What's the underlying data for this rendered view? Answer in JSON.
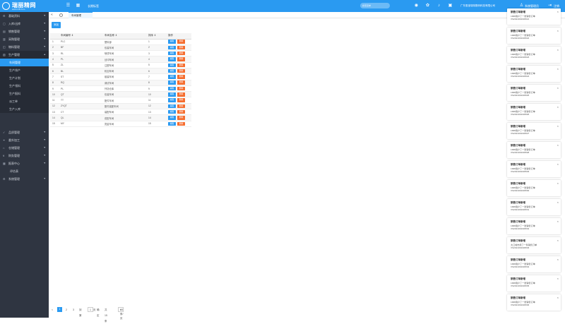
{
  "topbar": {
    "logo_text": "瑞丽精网",
    "logo_sub": "www.ruili.com",
    "menu_label": "长期标签",
    "search_placeholder": "搜索菜单",
    "company": "广东惠宝瑞帝数码科技有限公司",
    "user": "系统管理员",
    "logout": "注销",
    "colors": {
      "accent": "#2a9af1",
      "sidebar": "#2f3541",
      "danger": "#f56c2d"
    }
  },
  "sidebar": {
    "items": [
      {
        "label": "基础资料",
        "icon": "gear-icon"
      },
      {
        "label": "入库/出库",
        "icon": "box-icon"
      },
      {
        "label": "销售管理",
        "icon": "cart-icon"
      },
      {
        "label": "采购管理",
        "icon": "truck-icon"
      },
      {
        "label": "物料管理",
        "icon": "cube-icon"
      },
      {
        "label": "生产管理",
        "icon": "factory-icon"
      }
    ],
    "sub_items": [
      "车间管理",
      "生产排产",
      "生产计划",
      "生产领料",
      "生产报料",
      "派工单",
      "生产入库"
    ],
    "items2": [
      {
        "label": "品质管理",
        "icon": "check-icon"
      },
      {
        "label": "委外加工",
        "icon": "link-icon"
      },
      {
        "label": "仓储管理",
        "icon": "warehouse-icon"
      },
      {
        "label": "财务管理",
        "icon": "money-icon"
      },
      {
        "label": "报表中心",
        "icon": "chart-icon"
      },
      {
        "label": "评估表",
        "icon": ""
      },
      {
        "label": "系统管理",
        "icon": "settings-icon"
      }
    ]
  },
  "tabs": {
    "active": "车间管理"
  },
  "toolbar": {
    "add_label": "添加"
  },
  "table": {
    "headers": [
      "",
      "车间编号",
      "车间名称",
      "排序",
      "操作"
    ],
    "edit_label": "编辑",
    "delete_label": "删除",
    "rows": [
      [
        "1",
        "PLC",
        "塑料部",
        "1"
      ],
      [
        "2",
        "BF",
        "包装车间",
        "2"
      ],
      [
        "3",
        "RL",
        "喷漆车间",
        "3"
      ],
      [
        "4",
        "PL",
        "丝印车间",
        "4"
      ],
      [
        "5",
        "ZL",
        "注塑车间",
        "5"
      ],
      [
        "6",
        "BL",
        "机加车间",
        "6"
      ],
      [
        "7",
        "ST",
        "组装车间",
        "7"
      ],
      [
        "8",
        "RQ",
        "调试车间",
        "8"
      ],
      [
        "9",
        "PL",
        "外协仓库",
        "9"
      ],
      [
        "10",
        "QT",
        "包装车间",
        "10"
      ],
      [
        "11",
        "TT",
        "配件车间",
        "11"
      ],
      [
        "12",
        "ZYQT",
        "配件装配车间",
        "12"
      ],
      [
        "13",
        "CT",
        "装配车间",
        "13"
      ],
      [
        "14",
        "QL",
        "成型车间",
        "14"
      ],
      [
        "15",
        "MY",
        "烫金车间",
        "15"
      ]
    ]
  },
  "pager": {
    "prev": "<",
    "current": "1",
    "next_pages": [
      "2",
      "3"
    ],
    "goto": "到第",
    "page": "1",
    "page_unit": "页",
    "confirm": "确定",
    "total": "共 15 条",
    "size": "15 条/页"
  },
  "notifications": [
    {
      "title": "销售订单新增",
      "line1": "1688用户了一张销售订单",
      "line2": "XS2021091199521"
    },
    {
      "title": "销售订单新增",
      "line1": "1688用户了一张销售订单",
      "line2": "XS2021091199522"
    },
    {
      "title": "销售订单新增",
      "line1": "1688用户了一张销售订单",
      "line2": "XS2021091199523"
    },
    {
      "title": "销售订单新增",
      "line1": "1688用户了一张销售订单",
      "line2": "XS2021091199524"
    },
    {
      "title": "销售订单新增",
      "line1": "1688用户了一张销售订单",
      "line2": "XS2021091199525"
    },
    {
      "title": "销售订单新增",
      "line1": "1688用户了一张销售订单",
      "line2": "XS2021091199526"
    },
    {
      "title": "销售订单新增",
      "line1": "1688用户了一张销售订单",
      "line2": "XS2021091199527"
    },
    {
      "title": "销售订单新增",
      "line1": "1688用户了一张销售订单",
      "line2": "XS2021091199528"
    },
    {
      "title": "销售订单新增",
      "line1": "1688用户了一张销售订单",
      "line2": "XS2021091199529"
    },
    {
      "title": "销售订单新增",
      "line1": "1688用户了一张销售订单",
      "line2": "XS2021091199530"
    },
    {
      "title": "销售订单新增",
      "line1": "1688用户了一张销售订单",
      "line2": "XS2021091199531"
    },
    {
      "title": "销售订单新增",
      "line1": "1688用户了一张销售订单",
      "line2": "XS2021091199532"
    },
    {
      "title": "销售订单新增",
      "line1": "大口城市用了一条销售订单",
      "line2": "XS2021091199533"
    },
    {
      "title": "销售订单新增",
      "line1": "1688用户了一张销售订单",
      "line2": "XS2021091199534"
    },
    {
      "title": "销售订单新增",
      "line1": "1688用户了一张销售订单",
      "line2": "XS2021091199535"
    },
    {
      "title": "销售订单新增",
      "line1": "1688用户了一张销售订单",
      "line2": "XS2021091199536"
    }
  ]
}
